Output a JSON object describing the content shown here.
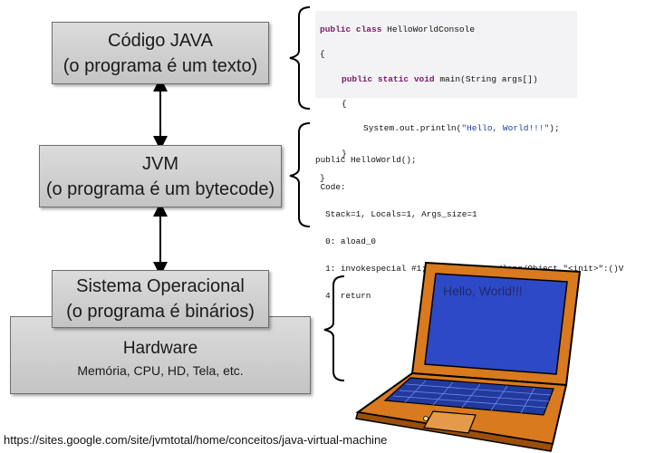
{
  "boxes": {
    "java": {
      "line1": "Código JAVA",
      "line2": "(o programa é um texto)"
    },
    "jvm": {
      "line1": "JVM",
      "line2": "(o programa é um bytecode)"
    },
    "os": {
      "line1": "Sistema Operacional",
      "line2": "(o programa é binários)"
    },
    "hardware": {
      "line1": "Hardware",
      "line2": "Memória, CPU, HD, Tela, etc."
    }
  },
  "java_code": {
    "l1_kw": "public class",
    "l1_rest": " HelloWorldConsole",
    "l2": "{",
    "l3_kw": "public static void",
    "l3_rest": " main(String args[])",
    "l4": "{",
    "l5_pre": "System.out.println(",
    "l5_str": "\"Hello, World!!!\"",
    "l5_post": ");",
    "l6": "}",
    "l7": "}"
  },
  "bytecode": {
    "lines": [
      "public HelloWorld();",
      " Code:",
      "  Stack=1, Locals=1, Args_size=1",
      "  0: aload_0",
      "  1: invokespecial #1; //Method java/lang/Object.\"<init>\":()V",
      "  4: return"
    ]
  },
  "laptop": {
    "screen_text": "Hello, World!!!"
  },
  "footer": {
    "url": "https://sites.google.com/site/jvmtotal/home/conceitos/java-virtual-machine"
  },
  "colors": {
    "box_fill": "#d0d0d0",
    "arrow": "#000000",
    "red_arrow": "#ff0000",
    "laptop_body": "#d97a1e",
    "laptop_screen": "#2d49c6"
  }
}
